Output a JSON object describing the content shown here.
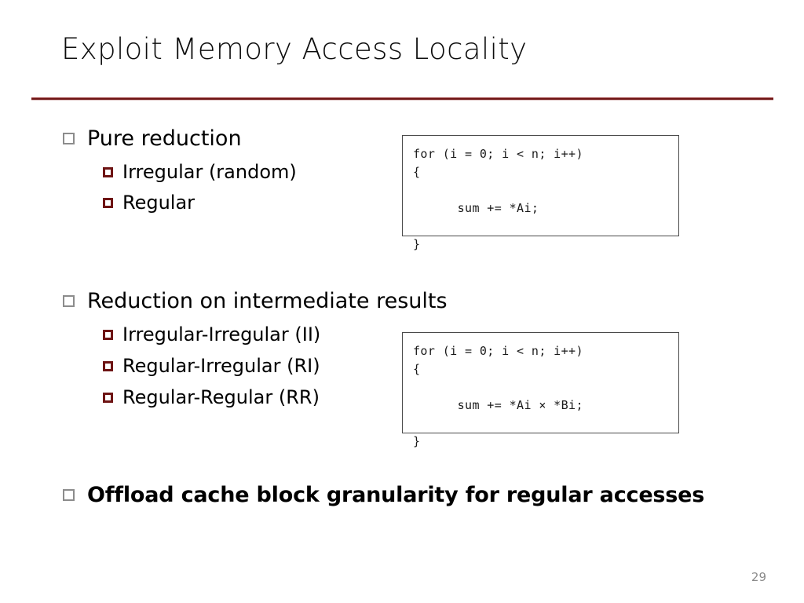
{
  "slide": {
    "title": "Exploit Memory Access Locality",
    "page_number": "29",
    "accent_color": "#6E1414",
    "marker_level1_color": "#8c8c8c",
    "marker_level2_color": "#6E1414"
  },
  "bullets": [
    {
      "level": 1,
      "label": "Pure reduction",
      "bold": false,
      "marker": "hollow-square-gray",
      "children": [
        {
          "level": 2,
          "label": "Irregular (random)",
          "marker": "filled-square-maroon"
        },
        {
          "level": 2,
          "label": "Regular",
          "marker": "filled-square-maroon"
        }
      ]
    },
    {
      "level": 1,
      "label": "Reduction on intermediate results",
      "bold": false,
      "marker": "hollow-square-gray",
      "children": [
        {
          "level": 2,
          "label": "Irregular-Irregular (II)",
          "marker": "filled-square-maroon"
        },
        {
          "level": 2,
          "label": "Regular-Irregular (RI)",
          "marker": "filled-square-maroon"
        },
        {
          "level": 2,
          "label": "Regular-Regular (RR)",
          "marker": "filled-square-maroon"
        }
      ]
    },
    {
      "level": 1,
      "label": "Offload cache block granularity for regular accesses",
      "bold": true,
      "marker": "hollow-square-gray",
      "children": []
    }
  ],
  "code_boxes": [
    {
      "name": "pure-reduction-code",
      "lines": [
        "for (i = 0; i < n; i++)",
        "{",
        "",
        "      sum += *Ai;",
        "",
        "}"
      ]
    },
    {
      "name": "intermediate-reduction-code",
      "lines": [
        "for (i = 0; i < n; i++)",
        "{",
        "",
        "      sum += *Ai × *Bi;",
        "",
        "}"
      ]
    }
  ]
}
